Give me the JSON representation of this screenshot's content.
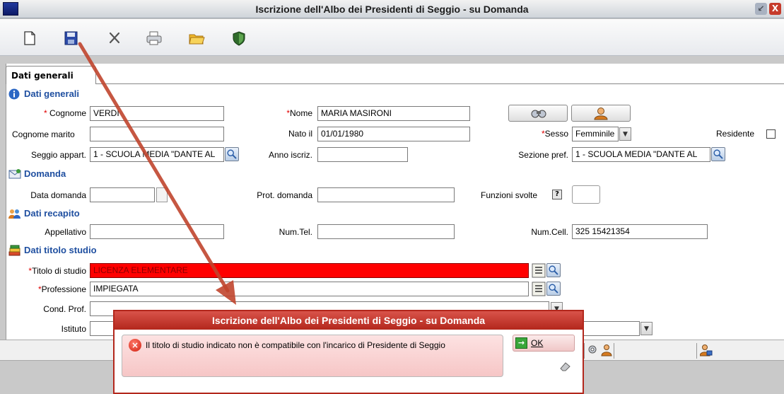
{
  "window": {
    "title": "Iscrizione dell'Albo dei Presidenti di Seggio - su Domanda"
  },
  "toolbar": {
    "icons": [
      "new-document-icon",
      "save-icon",
      "delete-icon",
      "print-icon",
      "open-folder-icon",
      "shield-icon"
    ]
  },
  "tabs": [
    {
      "label": "Dati generali"
    }
  ],
  "sections": {
    "dati_generali": "Dati generali",
    "domanda": "Domanda",
    "dati_recapito": "Dati recapito",
    "dati_titolo_studio": "Dati titolo studio"
  },
  "form": {
    "required_mark": "*",
    "cognome": {
      "label": "Cognome",
      "value": "VERDI"
    },
    "nome": {
      "label": "Nome",
      "value": "MARIA MASIRONI"
    },
    "cognome_marito": {
      "label": "Cognome marito",
      "value": ""
    },
    "nato_il": {
      "label": "Nato il",
      "value": "01/01/1980"
    },
    "sesso": {
      "label": "Sesso",
      "value": "Femminile"
    },
    "residente": {
      "label": "Residente",
      "checked": false
    },
    "seggio_appart": {
      "label": "Seggio appart.",
      "value": "1 - SCUOLA MEDIA \"DANTE AL"
    },
    "anno_iscriz": {
      "label": "Anno iscriz.",
      "value": ""
    },
    "sezione_pref": {
      "label": "Sezione pref.",
      "value": "1 - SCUOLA MEDIA \"DANTE AL"
    },
    "data_domanda": {
      "label": "Data domanda",
      "value": ""
    },
    "prot_domanda": {
      "label": "Prot. domanda",
      "value": ""
    },
    "funzioni_svolte": {
      "label": "Funzioni svolte",
      "help": "?",
      "value": ""
    },
    "appellativo": {
      "label": "Appellativo",
      "value": ""
    },
    "num_tel": {
      "label": "Num.Tel.",
      "value": ""
    },
    "num_cell": {
      "label": "Num.Cell.",
      "value": "325 15421354"
    },
    "titolo_studio": {
      "label": "Titolo di studio",
      "value": "LICENZA ELEMENTARE"
    },
    "professione": {
      "label": "Professione",
      "value": "IMPIEGATA"
    },
    "cond_prof": {
      "label": "Cond. Prof.",
      "value": ""
    },
    "istituto": {
      "label": "Istituto",
      "value": ""
    }
  },
  "dialog": {
    "title": "Iscrizione dell'Albo dei Presidenti di Seggio - su Domanda",
    "message": "Il titolo di studio indicato non è compatibile con l'incarico di Presidente di Seggio",
    "ok_label": "OK"
  },
  "colors": {
    "error_field": "#ff0000",
    "section_text": "#1f4fa0",
    "dialog_header": "#b3271c",
    "annotation_arrow": "#c0452e"
  }
}
